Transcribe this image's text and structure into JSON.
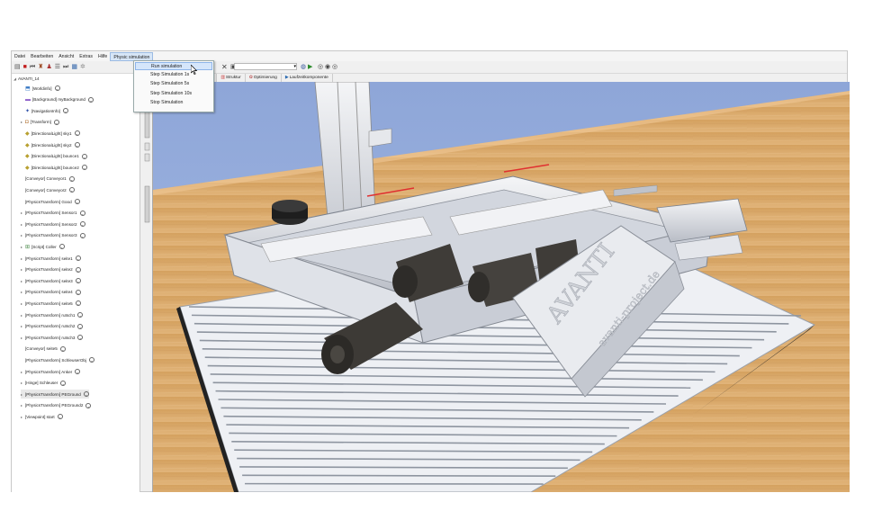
{
  "menu": {
    "items": [
      "Datei",
      "Bearbeiten",
      "Ansicht",
      "Extras",
      "Hilfe",
      "Physic simulation"
    ],
    "active_index": 5
  },
  "dropdown": {
    "items": [
      "Run simulation",
      "Step Simulation 1s",
      "Step Simulation 5s",
      "Step Simulation 10s",
      "Stop Simulation"
    ],
    "highlighted_index": 0
  },
  "tabs": [
    {
      "label": "ungen",
      "icon": "none"
    },
    {
      "label": "Struktur",
      "icon": "structure-icon"
    },
    {
      "label": "Optimierung",
      "icon": "optimize-icon"
    },
    {
      "label": "Laufzeitkomponente",
      "icon": "play-icon"
    }
  ],
  "tree": {
    "root": "AVANTI_14",
    "items": [
      {
        "label": "[Worldinfo]",
        "icon": "worldinfo"
      },
      {
        "label": "[Background] myBackground",
        "icon": "background"
      },
      {
        "label": "[NavigationInfo]",
        "icon": "navigation"
      },
      {
        "label": "[Transform]",
        "icon": "transform"
      },
      {
        "label": "[DirectionalLight] sky1",
        "icon": "light"
      },
      {
        "label": "[DirectionalLight] sky2",
        "icon": "light"
      },
      {
        "label": "[DirectionalLight] bounce1",
        "icon": "light"
      },
      {
        "label": "[DirectionalLight] bounce2",
        "icon": "light"
      },
      {
        "label": "[Conveyor] Conveyor1",
        "icon": "none"
      },
      {
        "label": "[Conveyor] Conveyor2",
        "icon": "none"
      },
      {
        "label": "[PhysicsTransform] Good",
        "icon": "none"
      },
      {
        "label": "[PhysicsTransform] Sensor1",
        "icon": "none"
      },
      {
        "label": "[PhysicsTransform] Sensor2",
        "icon": "none"
      },
      {
        "label": "[PhysicsTransform] Sensor3",
        "icon": "none"
      },
      {
        "label": "[Script] Coller",
        "icon": "script"
      },
      {
        "label": "[PhysicsTransform] seite1",
        "icon": "none"
      },
      {
        "label": "[PhysicsTransform] seite2",
        "icon": "none"
      },
      {
        "label": "[PhysicsTransform] seite3",
        "icon": "none"
      },
      {
        "label": "[PhysicsTransform] seite4",
        "icon": "none"
      },
      {
        "label": "[PhysicsTransform] seite5",
        "icon": "none"
      },
      {
        "label": "[PhysicsTransform] rutsch1",
        "icon": "none"
      },
      {
        "label": "[PhysicsTransform] rutsch2",
        "icon": "none"
      },
      {
        "label": "[PhysicsTransform] rutsch3",
        "icon": "none"
      },
      {
        "label": "[Conveyor] seite5",
        "icon": "none"
      },
      {
        "label": "[PhysicsTransform] SchleuserObj",
        "icon": "none"
      },
      {
        "label": "[PhysicsTransform] Anker",
        "icon": "none"
      },
      {
        "label": "[Hinge] Schleuser",
        "icon": "none"
      },
      {
        "label": "[PhysicsTransform] PEGround",
        "icon": "none"
      },
      {
        "label": "[PhysicsTransform] PEGround2",
        "icon": "none"
      },
      {
        "label": "[Viewpoint] start",
        "icon": "none"
      }
    ]
  },
  "colors": {
    "sky": "#93a9d9",
    "floor": "#d9aa6c",
    "menu_highlight": "#d5e6fb"
  },
  "scene": {
    "text1": "AVANTI",
    "text2": "avanti-project.de"
  }
}
